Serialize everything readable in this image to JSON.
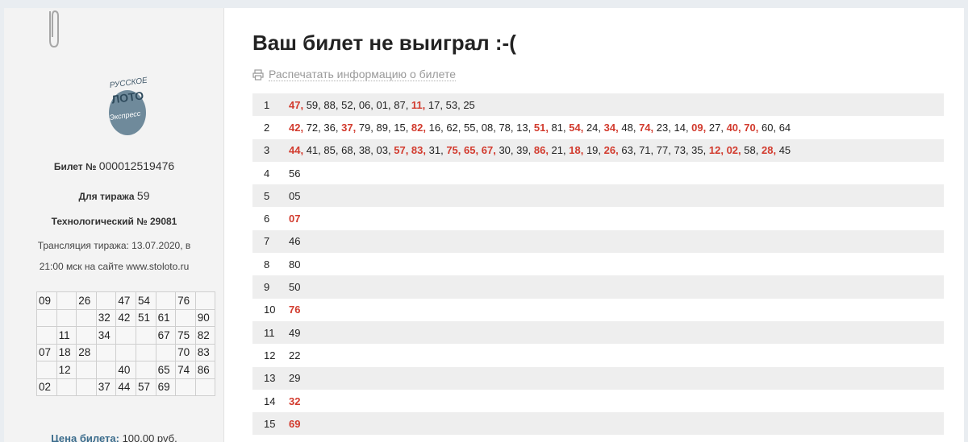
{
  "ticket": {
    "logo_text": [
      "РУССКОЕ",
      "ЛОТО",
      "Экспресс"
    ],
    "ticket_label": "Билет №",
    "ticket_number": "000012519476",
    "draw_label": "Для тиража",
    "draw_number": "59",
    "tech_label": "Технологический №",
    "tech_number": "29081",
    "broadcast_line1": "Трансляция тиража: 13.07.2020, в",
    "broadcast_line2": "21:00 мск на сайте www.stoloto.ru",
    "grid": [
      [
        "09",
        "",
        "26",
        "",
        "47",
        "54",
        "",
        "76",
        ""
      ],
      [
        "",
        "",
        "",
        "32",
        "42",
        "51",
        "61",
        "",
        "90"
      ],
      [
        "",
        "11",
        "",
        "34",
        "",
        "",
        "67",
        "75",
        "82"
      ],
      [
        "07",
        "18",
        "28",
        "",
        "",
        "",
        "",
        "70",
        "83"
      ],
      [
        "",
        "12",
        "",
        "",
        "40",
        "",
        "65",
        "74",
        "86"
      ],
      [
        "02",
        "",
        "",
        "37",
        "44",
        "57",
        "69",
        "",
        ""
      ]
    ],
    "price_label": "Цена билета:",
    "price_value": "100.00 руб."
  },
  "result": {
    "title": "Ваш билет не выиграл :-(",
    "print_label": "Распечатать информацию о билете",
    "print_icon": "printer-icon"
  },
  "colors": {
    "hit": "#d23b2e",
    "price_label": "#3b6c8c",
    "row_stripe": "#eeeeee"
  },
  "rounds": [
    {
      "n": "1",
      "nums": [
        [
          "47",
          true
        ],
        [
          "59",
          false
        ],
        [
          "88",
          false
        ],
        [
          "52",
          false
        ],
        [
          "06",
          false
        ],
        [
          "01",
          false
        ],
        [
          "87",
          false
        ],
        [
          "11",
          true
        ],
        [
          "17",
          false
        ],
        [
          "53",
          false
        ],
        [
          "25",
          false
        ]
      ]
    },
    {
      "n": "2",
      "nums": [
        [
          "42",
          true
        ],
        [
          "72",
          false
        ],
        [
          "36",
          false
        ],
        [
          "37",
          true
        ],
        [
          "79",
          false
        ],
        [
          "89",
          false
        ],
        [
          "15",
          false
        ],
        [
          "82",
          true
        ],
        [
          "16",
          false
        ],
        [
          "62",
          false
        ],
        [
          "55",
          false
        ],
        [
          "08",
          false
        ],
        [
          "78",
          false
        ],
        [
          "13",
          false
        ],
        [
          "51",
          true
        ],
        [
          "81",
          false
        ],
        [
          "54",
          true
        ],
        [
          "24",
          false
        ],
        [
          "34",
          true
        ],
        [
          "48",
          false
        ],
        [
          "74",
          true
        ],
        [
          "23",
          false
        ],
        [
          "14",
          false
        ],
        [
          "09",
          true
        ],
        [
          "27",
          false
        ],
        [
          "40",
          true
        ],
        [
          "70",
          true
        ],
        [
          "60",
          false
        ],
        [
          "64",
          false
        ]
      ]
    },
    {
      "n": "3",
      "nums": [
        [
          "44",
          true
        ],
        [
          "41",
          false
        ],
        [
          "85",
          false
        ],
        [
          "68",
          false
        ],
        [
          "38",
          false
        ],
        [
          "03",
          false
        ],
        [
          "57",
          true
        ],
        [
          "83",
          true
        ],
        [
          "31",
          false
        ],
        [
          "75",
          true
        ],
        [
          "65",
          true
        ],
        [
          "67",
          true
        ],
        [
          "30",
          false
        ],
        [
          "39",
          false
        ],
        [
          "86",
          true
        ],
        [
          "21",
          false
        ],
        [
          "18",
          true
        ],
        [
          "19",
          false
        ],
        [
          "26",
          true
        ],
        [
          "63",
          false
        ],
        [
          "71",
          false
        ],
        [
          "77",
          false
        ],
        [
          "73",
          false
        ],
        [
          "35",
          false
        ],
        [
          "12",
          true
        ],
        [
          "02",
          true
        ],
        [
          "58",
          false
        ],
        [
          "28",
          true
        ],
        [
          "45",
          false
        ]
      ]
    },
    {
      "n": "4",
      "nums": [
        [
          "56",
          false
        ]
      ]
    },
    {
      "n": "5",
      "nums": [
        [
          "05",
          false
        ]
      ]
    },
    {
      "n": "6",
      "nums": [
        [
          "07",
          true
        ]
      ]
    },
    {
      "n": "7",
      "nums": [
        [
          "46",
          false
        ]
      ]
    },
    {
      "n": "8",
      "nums": [
        [
          "80",
          false
        ]
      ]
    },
    {
      "n": "9",
      "nums": [
        [
          "50",
          false
        ]
      ]
    },
    {
      "n": "10",
      "nums": [
        [
          "76",
          true
        ]
      ]
    },
    {
      "n": "11",
      "nums": [
        [
          "49",
          false
        ]
      ]
    },
    {
      "n": "12",
      "nums": [
        [
          "22",
          false
        ]
      ]
    },
    {
      "n": "13",
      "nums": [
        [
          "29",
          false
        ]
      ]
    },
    {
      "n": "14",
      "nums": [
        [
          "32",
          true
        ]
      ]
    },
    {
      "n": "15",
      "nums": [
        [
          "69",
          true
        ]
      ]
    }
  ]
}
